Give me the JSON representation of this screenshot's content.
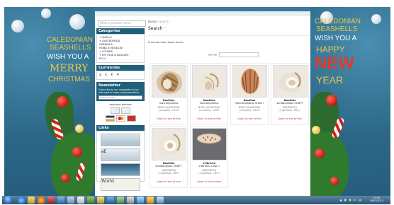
{
  "wallpaper": {
    "left": {
      "line1": "CALEDONIAN",
      "line2": "SEASHELLS",
      "line3": "WISH YOU A",
      "line4": "MERRY",
      "line5": "CHRISTMAS"
    },
    "right": {
      "line1": "CALEDONIAN",
      "line2": "SEASHELLS",
      "line3": "WISH YOU A",
      "line4": "HAPPY",
      "line5": "NEW",
      "line6": "YEAR"
    }
  },
  "site": {
    "search_placeholder": "Write a product name",
    "categories": {
      "title": "Categories",
      "items": [
        "+ SHELLS",
        "+ GASTROPODS",
        "  CARDIOLA",
        "  MOBIL E MUTACEE",
        "+ OTHERS",
        "+ FRJ TVSE & BOVLVES",
        "  R.O.C"
      ]
    },
    "currencies": {
      "title": "Currencies",
      "symbols": "$  £  €  ¥"
    },
    "newsletter": {
      "title": "Newsletter",
      "text": "Subscribe to our newsletter to be informed of news and promotions",
      "input_placeholder": "Email address"
    },
    "payment": {
      "title": "payment method"
    },
    "links": {
      "title": "Links",
      "thumb_labels": [
        "",
        "aE",
        "",
        "World"
      ]
    },
    "main": {
      "breadcrumb_home": "Home",
      "breadcrumb_sep": "/",
      "breadcrumb_current": "Search",
      "title": "Search",
      "title_suffix": "\"\"",
      "results_text": "6 results have been found",
      "sort_label": "Sort by",
      "products": [
        {
          "name": "Nautilus",
          "latin": "macromphalus",
          "origin": "NEW CALEDONIA",
          "size": "(Lineolis), 1999",
          "action": "Login to see prices"
        },
        {
          "name": "Nautilus",
          "latin": "macromphalus",
          "origin": "NEW CALEDONIA",
          "size": "(Lineolis), 1999",
          "action": "Login to see prices"
        },
        {
          "name": "Nautilus",
          "latin": "macromphalus Greek l",
          "origin": "NEW CALEDONIA",
          "size": "(Lineolis), 1999",
          "action": "Login to see prices"
        },
        {
          "name": "Nautilus",
          "latin": "scrobiculatus CHAPT",
          "origin": "INDONESIA",
          "size": "(Lightfoot, 786 )",
          "action": "Login to see prices"
        },
        {
          "name": "Nautilus",
          "latin": "scrobiculatus CHAPT",
          "origin": "INDONESIA",
          "size": "( Lightfoot, 786 )",
          "action": "Login to see prices"
        },
        {
          "name": "Cribraria",
          "latin": "cribraria n.ssp. I",
          "origin": "INDONESIA",
          "size": "( Lightfoot, 786 )",
          "action": "Login to see prices"
        }
      ]
    }
  },
  "taskbar": {
    "tray": "▲ ◧ ▮ ◂) ▤",
    "time": "10:45",
    "date": "19/01/2013"
  },
  "colors": {
    "accent": "#1f5f7a",
    "price_red": "#c0392b",
    "wallpaper_blue": "#2f6b8d",
    "title_gold": "#e8c84a",
    "new_year_red": "#e23a2a"
  }
}
